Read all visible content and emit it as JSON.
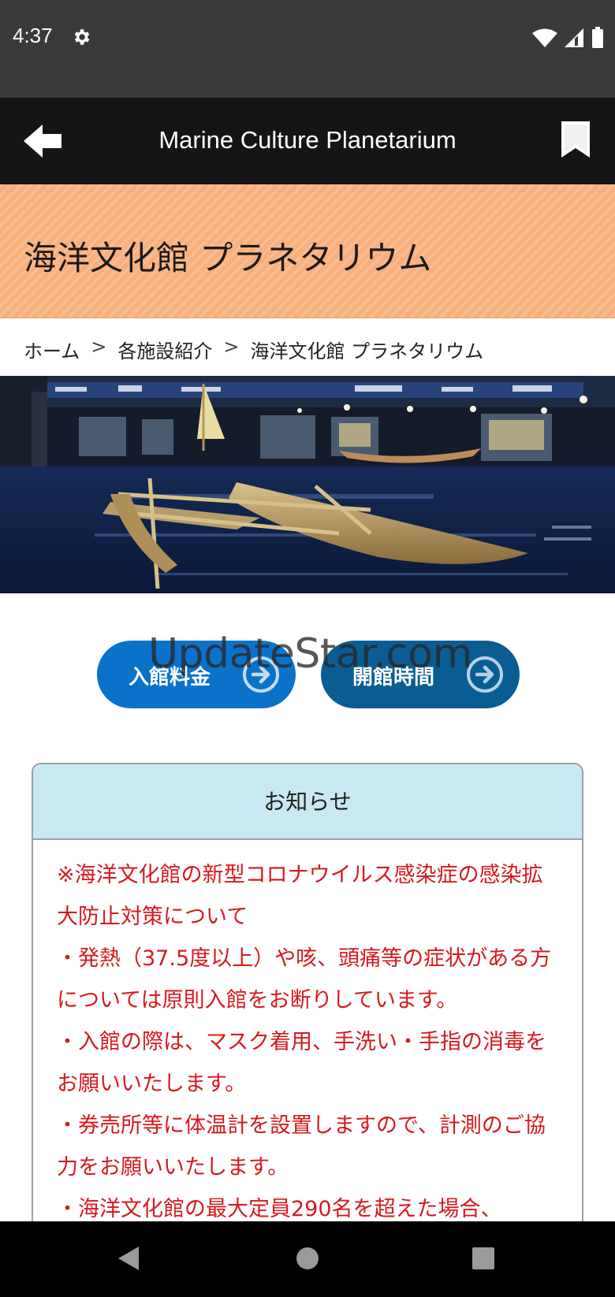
{
  "status_bar": {
    "time": "4:37",
    "icons": [
      "gear-icon",
      "wifi-icon",
      "signal-icon",
      "battery-icon"
    ]
  },
  "app_bar": {
    "title": "Marine Culture Planetarium",
    "back_icon": "arrow-left-icon",
    "bookmark_icon": "bookmark-icon"
  },
  "hero": {
    "title": "海洋文化館 プラネタリウム"
  },
  "breadcrumb": {
    "items": [
      "ホーム",
      "各施設紹介",
      "海洋文化館 プラネタリウム"
    ],
    "separator": ">"
  },
  "buttons": {
    "fee": "入館料金",
    "hours": "開館時間"
  },
  "watermark": "UpdateStar.com",
  "notice": {
    "header": "お知らせ",
    "lines": [
      "※海洋文化館の新型コロナウイルス感染症の感染拡大防止対策について",
      "・発熱（37.5度以上）や咳、頭痛等の症状がある方については原則入館をお断りしています。",
      "・入館の際は、マスク着用、手洗い・手指の消毒をお願いいたします。",
      "・券売所等に体温計を設置しますので、計測のご協力をお願いいたします。",
      "・海洋文化館の最大定員290名を超えた場合、"
    ]
  },
  "colors": {
    "hero_bg": "#f7b07c",
    "fee_button": "#0b72c9",
    "hours_button": "#0a5d93",
    "notice_header": "#c8e9f2",
    "notice_text": "#d7191c"
  }
}
